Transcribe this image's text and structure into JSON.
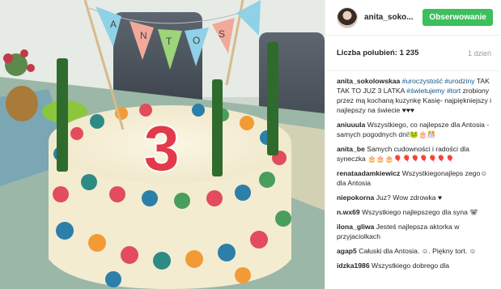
{
  "header": {
    "username": "anita_soko...",
    "follow_label": "Obserwowanie"
  },
  "meta": {
    "likes": "Liczba polubień: 1 235",
    "age": "1 dzień"
  },
  "caption": {
    "user": "anita_sokolowskaa",
    "tag1": "#uroczystość",
    "tag2": "#urodziny",
    "text1": "TAK TAK TO JUZ 3 LATKA",
    "tag3": "#świetujemy",
    "tag4": "#tort",
    "text2": "zrobiony przez mą kochaną kuzynkę Kasię- najpiękniejszy i najlepszy na świecie ♥♥♥"
  },
  "comments": [
    {
      "user": "aniuuula",
      "text": "Wszystkiego, co najlepsze dla Antosia - samych pogodnych dni!🐸🎂🎊"
    },
    {
      "user": "anita_be",
      "text": "Samych cudowności i radości dla syneczka 🎂🎂🎂🎈🎈🎈🎈🎈🎈🎈"
    },
    {
      "user": "renataadamkiewicz",
      "text": "Wszystkiegonajleps zego☺dla Antosia"
    },
    {
      "user": "niepokorna",
      "text": "Juz? Wow zdrowka ♥"
    },
    {
      "user": "n.wx69",
      "text": "Wszystkiego najlepszego dla syna 🐨"
    },
    {
      "user": "ilona_gliwa",
      "text": "Jesteś najlepsza aktorka w przyjaciolkach"
    },
    {
      "user": "agap5",
      "text": "Całuski dla Antosia. ☺. Piękny tort. ☺"
    },
    {
      "user": "idzka1986",
      "text": "Wszystkiego dobrego dla"
    }
  ],
  "photo": {
    "banner_letters": [
      "A",
      "N",
      "T",
      "O",
      "S"
    ],
    "candle_number": "3"
  },
  "colors": {
    "follow": "#3cbf5c",
    "hashtag": "#125688"
  }
}
